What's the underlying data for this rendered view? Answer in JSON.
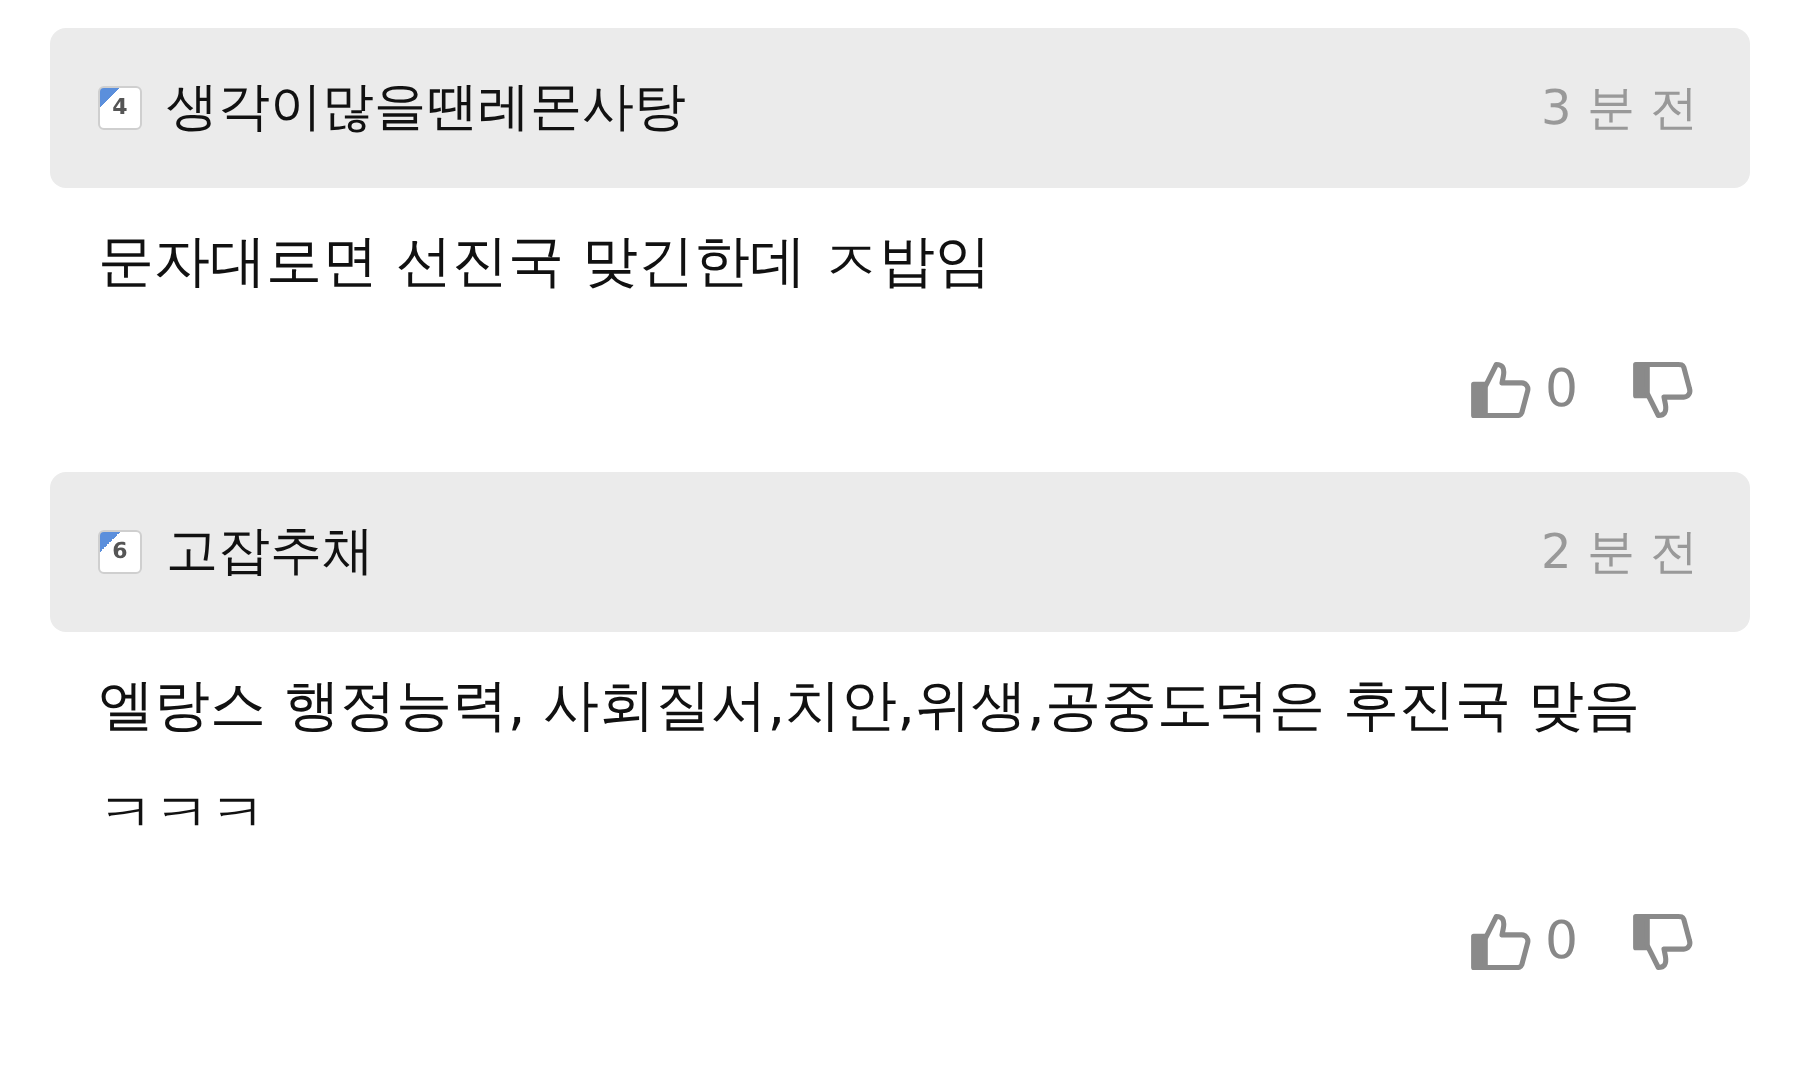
{
  "comments": [
    {
      "level": "4",
      "author": "생각이많을땐레몬사탕",
      "time": "3 분 전",
      "text": "문자대로면 선진국 맞긴한데 ㅈ밥임",
      "likes": "0"
    },
    {
      "level": "6",
      "author": "고잡추채",
      "time": "2 분 전",
      "text": "엘랑스 행정능력, 사회질서,치안,위생,공중도덕은 후진국 맞음 ㅋㅋㅋ",
      "likes": "0"
    }
  ]
}
